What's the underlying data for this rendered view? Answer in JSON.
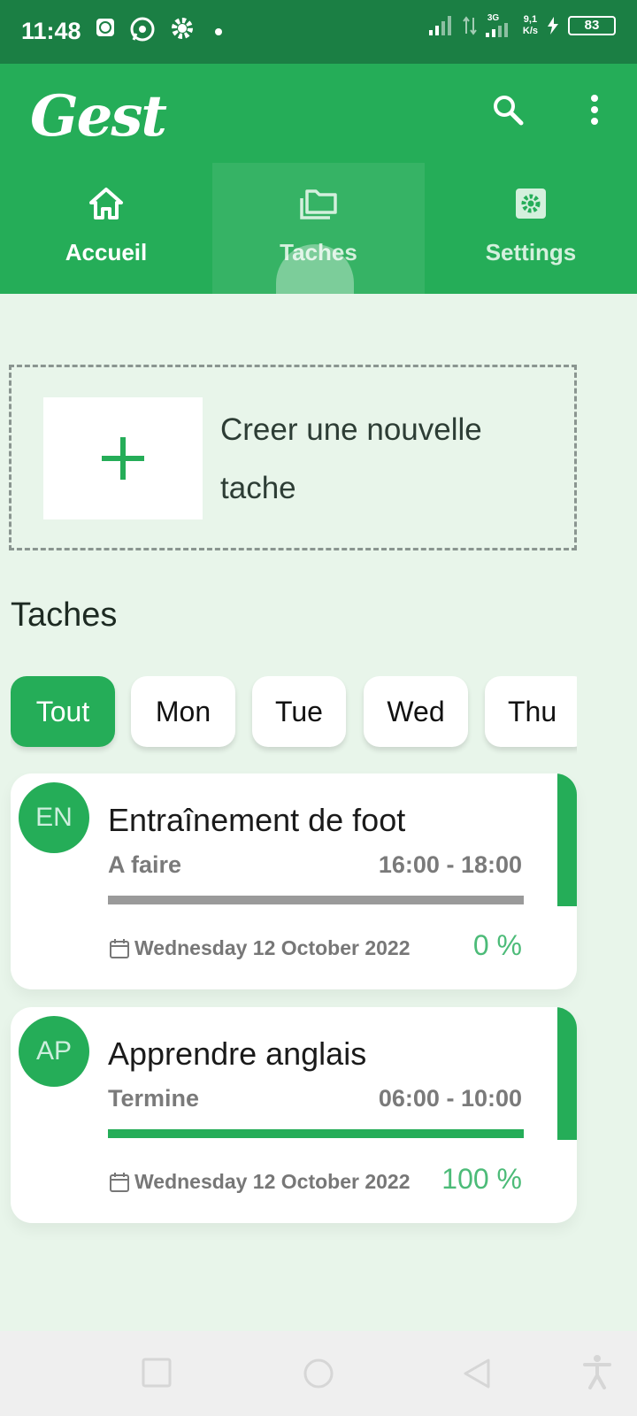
{
  "status_bar": {
    "time": "11:48",
    "net_speed_top": "9,1",
    "net_speed_bottom": "K/s",
    "network_type": "3G",
    "battery": "83"
  },
  "app": {
    "logo": "Gest"
  },
  "tabs": [
    {
      "label": "Accueil",
      "icon": "home-icon"
    },
    {
      "label": "Taches",
      "icon": "folders-icon"
    },
    {
      "label": "Settings",
      "icon": "settings-icon"
    }
  ],
  "create": {
    "label": "Creer une nouvelle tache"
  },
  "tasks_section": {
    "title": "Taches"
  },
  "filters": [
    "Tout",
    "Mon",
    "Tue",
    "Wed",
    "Thu"
  ],
  "tasks": [
    {
      "initials": "EN",
      "title": "Entraînement de foot",
      "status": "A faire",
      "time": "16:00 - 18:00",
      "progress": 0,
      "date": "Wednesday 12 October 2022",
      "percent_label": "0 %"
    },
    {
      "initials": "AP",
      "title": "Apprendre anglais",
      "status": "Termine",
      "time": "06:00 - 10:00",
      "progress": 100,
      "date": "Wednesday 12 October 2022",
      "percent_label": "100 %"
    }
  ],
  "colors": {
    "status_bar": "#1b7f44",
    "primary": "#25ad58",
    "background": "#e8f5ea"
  }
}
